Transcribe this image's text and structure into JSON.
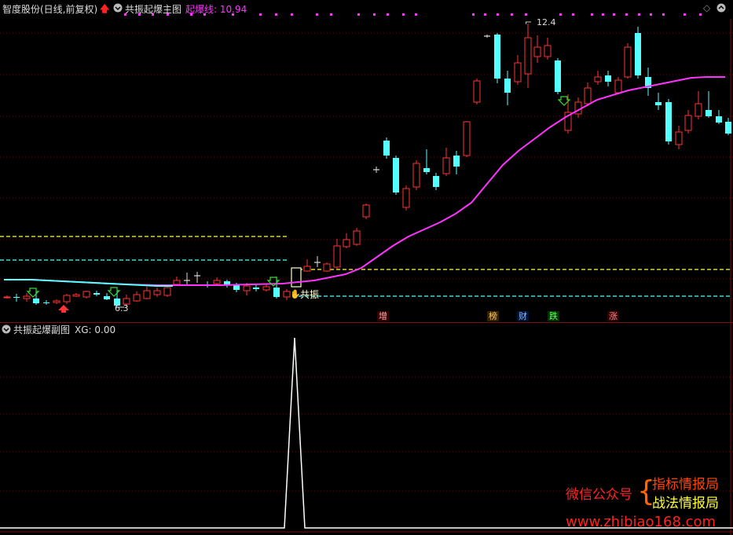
{
  "header": {
    "stock": "智度股份(日线,前复权)",
    "main_title": "共振起爆主图",
    "indicator_label": "起爆线: 10.94"
  },
  "sub_header": {
    "title": "共振起爆副图",
    "xg_label": "XG: 0.00"
  },
  "annotations": {
    "high_label": "12.40",
    "low_label": "6.30",
    "resonance_label": "共振"
  },
  "event_markers": [
    "增",
    "榜",
    "财",
    "跌",
    "涨"
  ],
  "watermark": {
    "left": "微信公众号",
    "right_top": "指标情报局",
    "right_bottom": "战法情报局",
    "url": "www.zhibiao168.com"
  },
  "colors": {
    "up": "#ff3333",
    "down": "#55ffff",
    "ma_line": "#ff33ff",
    "ma_early": "#55ffff",
    "dash_yellow": "#ffff44",
    "dash_cyan": "#55ffff",
    "watermark_red": "#ff2222",
    "watermark_yellow": "#ffff33"
  },
  "chart_data": {
    "type": "candlestick",
    "title": "共振起爆主图",
    "price_labels": [
      12.4,
      6.3
    ],
    "indicator_value": 10.94,
    "sub_chart": {
      "title": "共振起爆副图",
      "series": "XG",
      "current_value": 0.0
    }
  }
}
